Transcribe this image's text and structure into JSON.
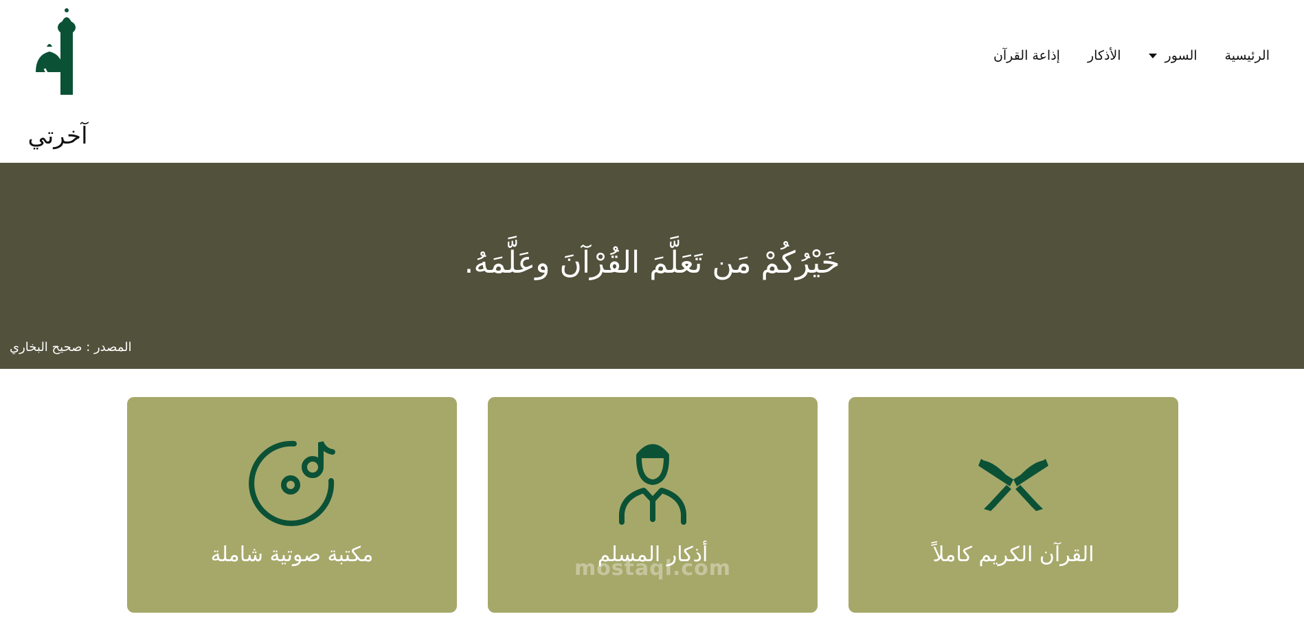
{
  "brand": {
    "name": "آخرتي",
    "color": "#0b5136"
  },
  "nav": {
    "items": [
      {
        "label": "إذاعة القرآن"
      },
      {
        "label": "الأذكار"
      },
      {
        "label": "السور"
      },
      {
        "label": "الرئيسية"
      }
    ]
  },
  "hero": {
    "quote": "خَيْرُكُمْ مَن تَعَلَّمَ القُرْآنَ وعَلَّمَهُ.",
    "source": "المصدر : صحيح البخاري",
    "background": "#51513c"
  },
  "cards": [
    {
      "title": "القرآن الكريم كاملاً",
      "icon": "quran-book-icon"
    },
    {
      "title": "أذكار المسلم",
      "icon": "muslim-person-icon"
    },
    {
      "title": "مكتبة صوتية شاملة",
      "icon": "music-disc-icon"
    }
  ],
  "colors": {
    "card_bg": "#a6a86a",
    "icon_green": "#0b5136"
  },
  "watermark": {
    "text": "mostaql.com"
  }
}
